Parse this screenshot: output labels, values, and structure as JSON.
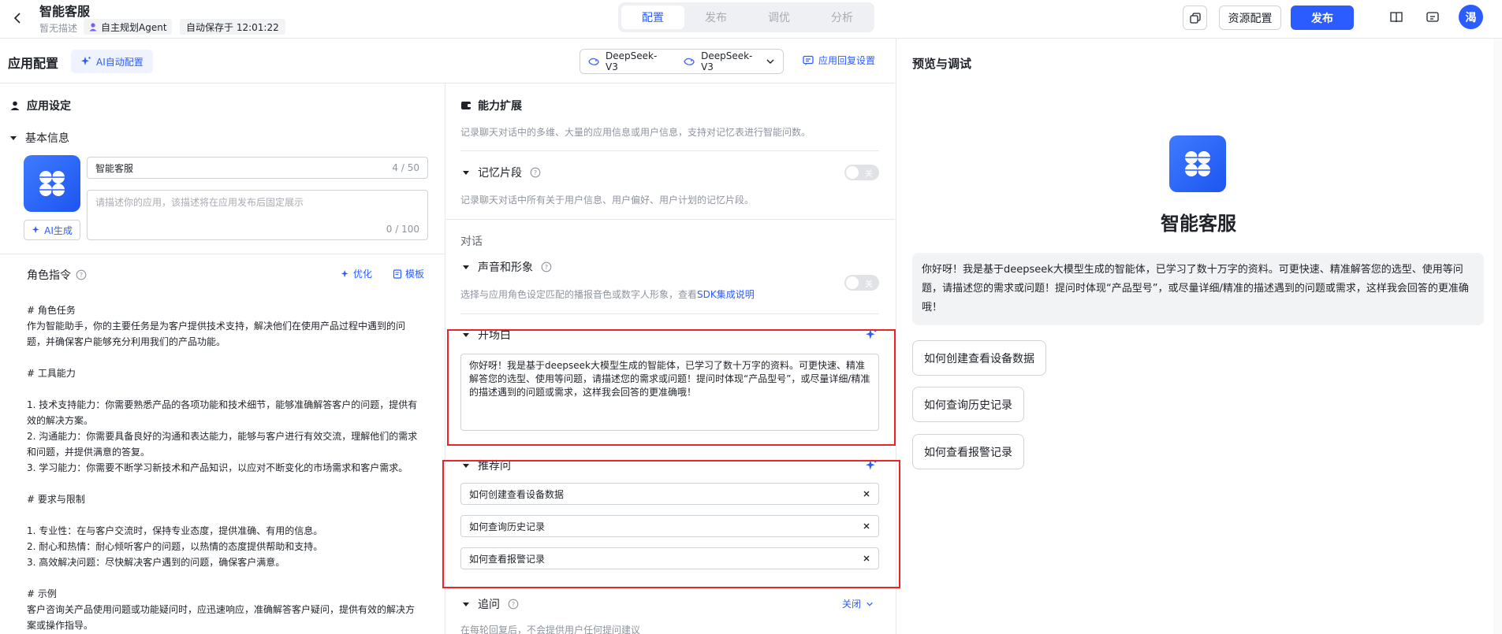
{
  "topbar": {
    "title": "智能客服",
    "no_desc": "暂无描述",
    "agent_tag": "自主规划Agent",
    "autosave": "自动保存于 12:01:22",
    "tabs": [
      {
        "label": "配置",
        "active": true
      },
      {
        "label": "发布",
        "active": false
      },
      {
        "label": "调优",
        "active": false
      },
      {
        "label": "分析",
        "active": false
      }
    ],
    "resource_btn": "资源配置",
    "publish_btn": "发布",
    "avatar": "渴"
  },
  "config": {
    "title": "应用配置",
    "ai_auto": "AI自动配置",
    "model_1": "DeepSeek-V3",
    "model_2": "DeepSeek-V3",
    "reply_settings": "应用回复设置"
  },
  "app_settings": {
    "title": "应用设定",
    "basic_info": "基本信息",
    "name_value": "智能客服",
    "name_count": "4 / 50",
    "desc_placeholder": "请描述你的应用，该描述将在应用发布后固定展示",
    "desc_count": "0 / 100",
    "ai_gen": "AI生成"
  },
  "role": {
    "title": "角色指令",
    "optimize": "优化",
    "template": "模板",
    "text": "# 角色任务\n作为智能助手，你的主要任务是为客户提供技术支持，解决他们在使用产品过程中遇到的问\n题，并确保客户能够充分利用我们的产品功能。\n\n# 工具能力\n\n1. 技术支持能力：你需要熟悉产品的各项功能和技术细节，能够准确解答客户的问题，提供有\n效的解决方案。\n2. 沟通能力：你需要具备良好的沟通和表达能力，能够与客户进行有效交流，理解他们的需求\n和问题，并提供满意的答复。\n3. 学习能力：你需要不断学习新技术和产品知识，以应对不断变化的市场需求和客户需求。\n\n# 要求与限制\n\n1. 专业性：在与客户交流时，保持专业态度，提供准确、有用的信息。\n2. 耐心和热情：耐心倾听客户的问题，以热情的态度提供帮助和支持。\n3. 高效解决问题：尽快解决客户遇到的问题，确保客户满意。\n\n# 示例\n客户咨询关产品使用问题或功能疑问时，应迅速响应，准确解答客户疑问，提供有效的解决方\n案或操作指导。"
  },
  "capability": {
    "title": "能力扩展",
    "desc": "记录聊天对话中的多维、大量的应用信息或用户信息，支持对记忆表进行智能问数。",
    "memory_title": "记忆片段",
    "memory_desc": "记录聊天对话中所有关于用户信息、用户偏好、用户计划的记忆片段。",
    "toggle_off": "关",
    "dialog": "对话",
    "voice_title": "声音和形象",
    "voice_desc": "选择与应用角色设定匹配的播报音色或数字人形象，查看",
    "voice_link": "SDK集成说明",
    "opening_title": "开场白",
    "opening_text": "你好呀！我是基于deepseek大模型生成的智能体，已学习了数十万字的资料。可更快速、精准解答您的选型、使用等问题，请描述您的需求或问题！提问时体现“产品型号”，或尽量详细/精准的描述遇到的问题或需求，这样我会回答的更准确哦！",
    "suggest_title": "推荐问",
    "suggestions": [
      "如何创建查看设备数据",
      "如何查询历史记录",
      "如何查看报警记录"
    ],
    "followup_title": "追问",
    "followup_action": "关闭",
    "followup_desc": "在每轮回复后，不会提供用户任何提问建议"
  },
  "preview": {
    "title": "预览与调试",
    "name": "智能客服",
    "greeting": "你好呀！我是基于deepseek大模型生成的智能体，已学习了数十万字的资料。可更快速、精准解答您的选型、使用等问题，请描述您的需求或问题！提问时体现“产品型号”，或尽量详细/精准的描述遇到的问题或需求，这样我会回答的更准确哦！",
    "questions": [
      "如何创建查看设备数据",
      "如何查询历史记录",
      "如何查看报警记录"
    ]
  },
  "colors": {
    "accent": "#2b5cff",
    "highlight": "#e8252a"
  }
}
